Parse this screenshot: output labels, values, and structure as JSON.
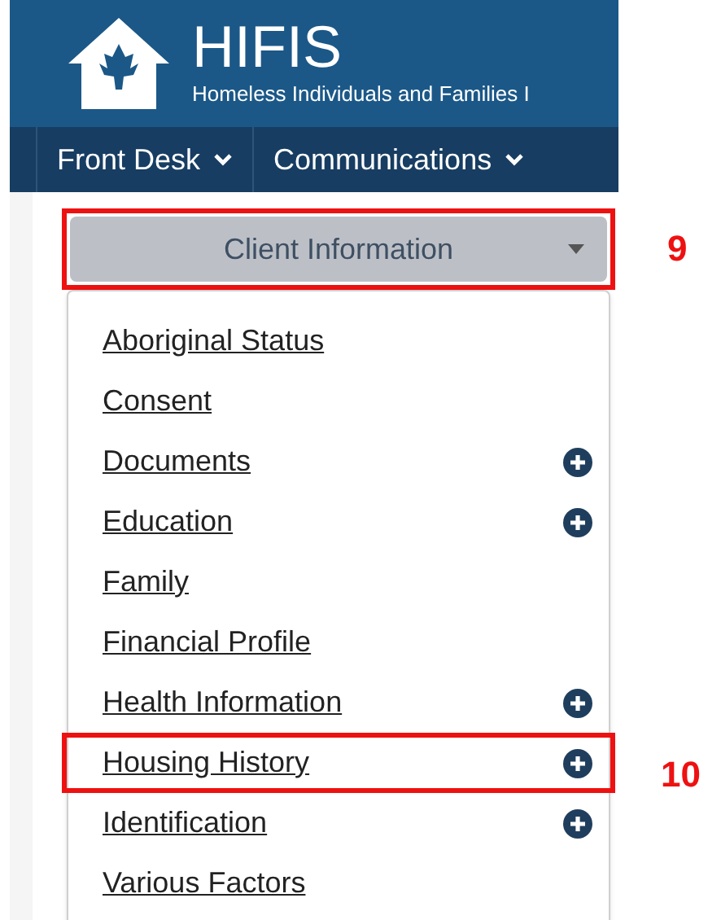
{
  "header": {
    "title": "HIFIS",
    "subtitle": "Homeless Individuals and Families I"
  },
  "nav": [
    {
      "label": "Front Desk"
    },
    {
      "label": "Communications"
    }
  ],
  "dropdown": {
    "label": "Client Information",
    "highlighted": true,
    "callout": "9"
  },
  "menu_items": [
    {
      "label": "Aboriginal Status",
      "has_add": false,
      "highlighted": false
    },
    {
      "label": "Consent",
      "has_add": false,
      "highlighted": false
    },
    {
      "label": "Documents",
      "has_add": true,
      "highlighted": false
    },
    {
      "label": "Education",
      "has_add": true,
      "highlighted": false
    },
    {
      "label": "Family",
      "has_add": false,
      "highlighted": false
    },
    {
      "label": "Financial Profile",
      "has_add": false,
      "highlighted": false
    },
    {
      "label": "Health Information",
      "has_add": true,
      "highlighted": false
    },
    {
      "label": "Housing History",
      "has_add": true,
      "highlighted": true,
      "callout": "10"
    },
    {
      "label": "Identification",
      "has_add": true,
      "highlighted": false
    },
    {
      "label": "Various Factors",
      "has_add": false,
      "highlighted": false
    }
  ]
}
